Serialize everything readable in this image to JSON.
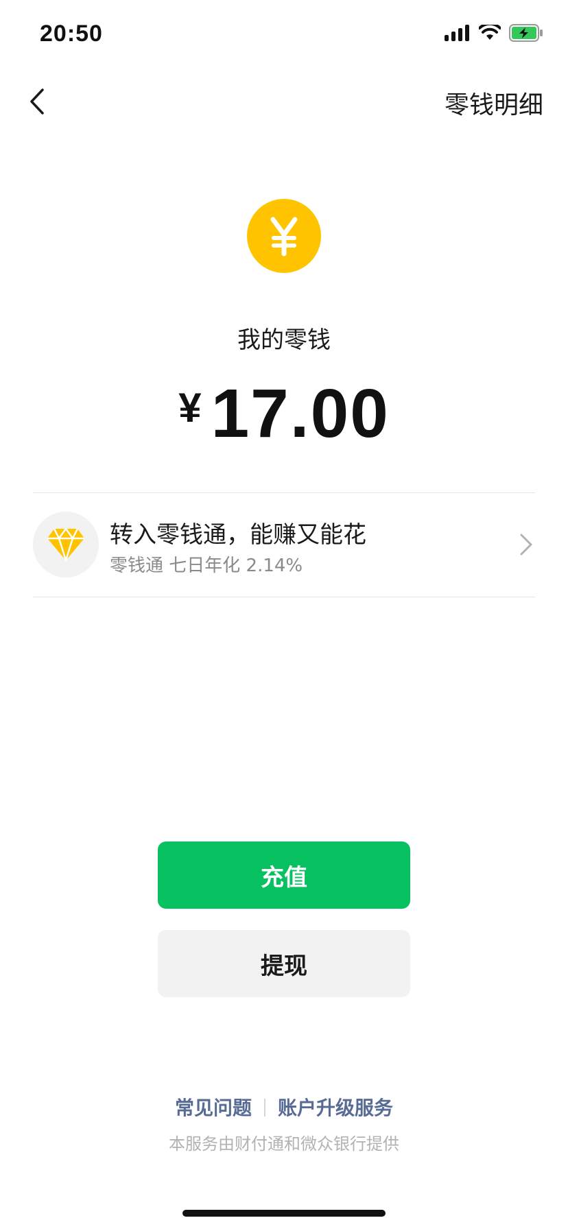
{
  "status_bar": {
    "time": "20:50",
    "icons": [
      "signal-icon",
      "wifi-icon",
      "battery-charging-icon"
    ]
  },
  "nav": {
    "back_icon": "chevron-left-icon",
    "detail_link": "零钱明细"
  },
  "balance": {
    "coin_symbol": "¥",
    "label": "我的零钱",
    "currency": "¥",
    "amount": "17.00"
  },
  "promo": {
    "icon": "diamond-icon",
    "title": "转入零钱通，能赚又能花",
    "subtitle": "零钱通 七日年化 2.14%",
    "chevron": "chevron-right-icon"
  },
  "actions": {
    "top_up": "充值",
    "withdraw": "提现"
  },
  "footer": {
    "faq": "常见问题",
    "upgrade": "账户升级服务",
    "note": "本服务由财付通和微众银行提供"
  },
  "colors": {
    "primary_green": "#07C160",
    "coin_yellow": "#FFC300",
    "link_blue": "#576B95"
  }
}
